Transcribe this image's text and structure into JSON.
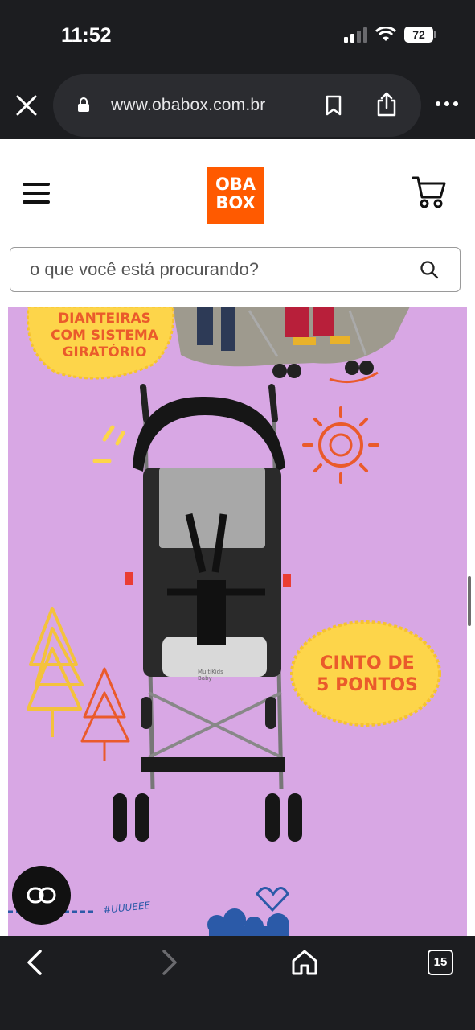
{
  "status": {
    "time": "11:52",
    "battery": "72"
  },
  "browser": {
    "url": "www.obabox.com.br",
    "tab_count": "15"
  },
  "header": {
    "logo_line1": "OBA",
    "logo_line2": "BOX"
  },
  "search": {
    "placeholder": "o que você está procurando?"
  },
  "banner": {
    "badge_top_line1": "DIANTEIRAS",
    "badge_top_line2": "COM SISTEMA",
    "badge_top_line3": "GIRATÓRIO",
    "badge_right_line1": "CINTO DE",
    "badge_right_line2": "5 PONTOS",
    "brand_on_seat": "MultiKids Baby",
    "doodle_text": "#UUUEEE",
    "background_color": "#d8a7e4",
    "accent_color": "#ea5a2b",
    "badge_color": "#fdd54a"
  },
  "colors": {
    "brand": "#ff5a00",
    "chrome": "#1c1d20"
  },
  "icons": [
    "close-icon",
    "lock-icon",
    "bookmark-icon",
    "share-icon",
    "more-icon",
    "menu-icon",
    "cart-icon",
    "search-icon",
    "link-icon",
    "back-icon",
    "forward-icon",
    "home-icon",
    "tabs-icon"
  ]
}
